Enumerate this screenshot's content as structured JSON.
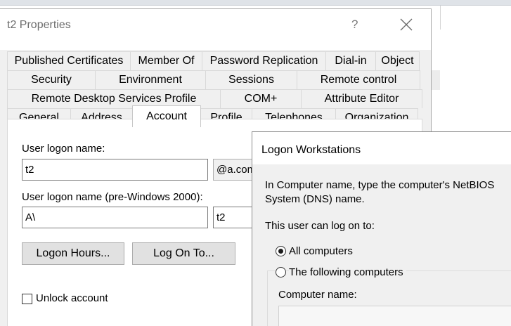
{
  "window": {
    "title": "t2 Properties",
    "help_glyph": "?",
    "close_glyph": "×"
  },
  "tabs": {
    "row1": [
      "Published Certificates",
      "Member Of",
      "Password Replication",
      "Dial-in",
      "Object"
    ],
    "row2": [
      "Security",
      "Environment",
      "Sessions",
      "Remote control"
    ],
    "row3": [
      "Remote Desktop Services Profile",
      "COM+",
      "Attribute Editor"
    ],
    "row4": [
      "General",
      "Address",
      "Account",
      "Profile",
      "Telephones",
      "Organization"
    ],
    "active": "Account"
  },
  "account": {
    "logon_name_label": "User logon name:",
    "logon_name_value": "t2",
    "domain_suffix_value": "@a.com",
    "pre2000_label": "User logon name (pre-Windows 2000):",
    "pre2000_domain_value": "A\\",
    "pre2000_name_value": "t2",
    "logon_hours_button": "Logon Hours...",
    "log_on_to_button": "Log On To...",
    "unlock_label": "Unlock account",
    "unlock_checked": false
  },
  "logon_workstations": {
    "title": "Logon Workstations",
    "instruction_line1": "In Computer name, type the computer's NetBIOS",
    "instruction_line2": "System (DNS) name.",
    "can_log_on_label": "This user can log on to:",
    "all_computers_label": "All computers",
    "following_computers_label": "The following computers",
    "selected_option": "All computers",
    "computer_name_label": "Computer name:",
    "computer_name_value": ""
  },
  "background": {
    "stray_text": "."
  }
}
